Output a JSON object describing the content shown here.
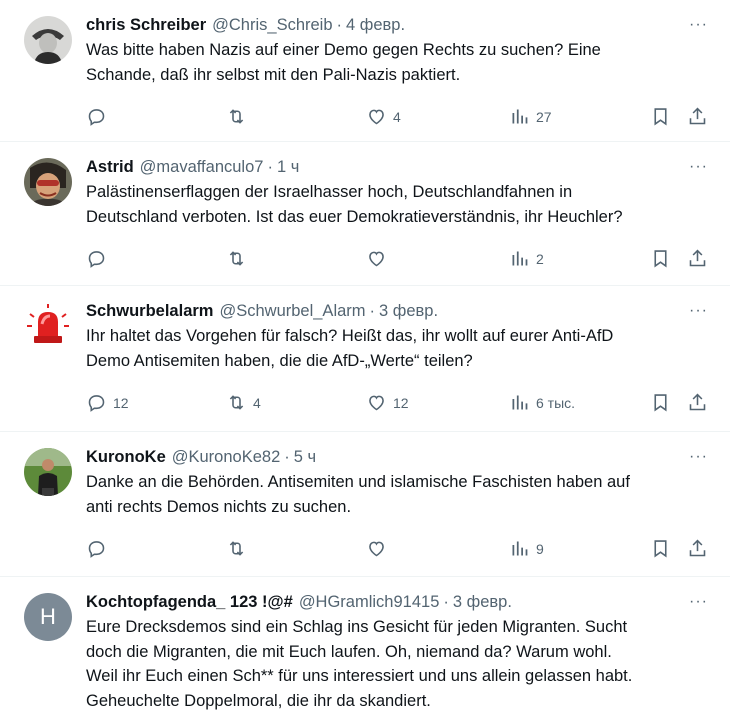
{
  "tweets": [
    {
      "name": "chris Schreiber",
      "handle": "@Chris_Schreib",
      "time": "4 февр.",
      "text": [
        "Was bitte haben Nazis auf einer Demo gegen Rechts zu suchen? Eine",
        "Schande, daß ihr selbst mit den Pali-Nazis paktiert."
      ],
      "replies": "",
      "retweets": "",
      "likes": "4",
      "views": "27",
      "avatar": "photo-figure"
    },
    {
      "name": "Astrid",
      "handle": "@mavaffanculo7",
      "time": "1 ч",
      "text": [
        "Palästinenserflaggen der Israelhasser hoch, Deutschlandfahnen in",
        "Deutschland verboten. Ist das euer Demokratieverständnis, ihr Heuchler?"
      ],
      "replies": "",
      "retweets": "",
      "likes": "",
      "views": "2",
      "avatar": "photo-face"
    },
    {
      "name": "Schwurbelalarm",
      "handle": "@Schwurbel_Alarm",
      "time": "3 февр.",
      "text": [
        "Ihr haltet das Vorgehen für falsch? Heißt das, ihr wollt auf eurer Anti-AfD",
        "Demo Antisemiten haben, die die AfD-„Werte“ teilen?"
      ],
      "replies": "12",
      "retweets": "4",
      "likes": "12",
      "views": "6 тыс.",
      "avatar": "siren"
    },
    {
      "name": "KuronoKe",
      "handle": "@KuronoKe82",
      "time": "5 ч",
      "text": [
        "Danke an die Behörden. Antisemiten und islamische Faschisten haben auf",
        "anti rechts Demos nichts zu suchen."
      ],
      "replies": "",
      "retweets": "",
      "likes": "",
      "views": "9",
      "avatar": "photo-person"
    },
    {
      "name": "Kochtopfagenda_ 123 !@#",
      "handle": "@HGramlich91415",
      "time": "3 февр.",
      "text": [
        "Eure Drecksdemos sind ein Schlag ins Gesicht für jeden Migranten. Sucht",
        "doch die Migranten, die mit Euch laufen. Oh, niemand da? Warum wohl.",
        "Weil ihr Euch einen Sch** für uns interessiert und uns allein gelassen habt.",
        "Geheuchelte Doppelmoral, die ihr da skandiert."
      ],
      "avatar_letter": "H",
      "avatar": "letter"
    }
  ],
  "ui": {
    "more_glyph": "···",
    "dot": "·"
  },
  "colors": {
    "text": "#0f1419",
    "secondary": "#536471",
    "border": "#eff3f4",
    "avatar_letter_bg": "#7c8a96"
  },
  "icons": [
    "reply-icon",
    "retweet-icon",
    "like-icon",
    "views-icon",
    "bookmark-icon",
    "share-icon",
    "more-icon"
  ]
}
